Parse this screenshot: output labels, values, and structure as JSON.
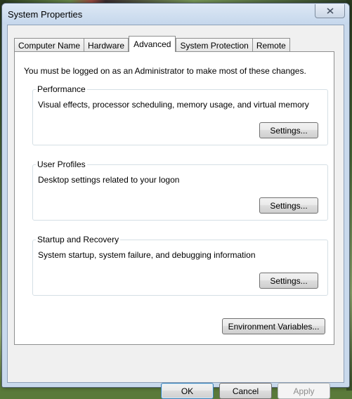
{
  "window": {
    "title": "System Properties",
    "close_icon": "close-icon"
  },
  "tabs": [
    {
      "label": "Computer Name",
      "active": false
    },
    {
      "label": "Hardware",
      "active": false
    },
    {
      "label": "Advanced",
      "active": true
    },
    {
      "label": "System Protection",
      "active": false
    },
    {
      "label": "Remote",
      "active": false
    }
  ],
  "advanced": {
    "admin_note": "You must be logged on as an Administrator to make most of these changes.",
    "performance": {
      "title": "Performance",
      "description": "Visual effects, processor scheduling, memory usage, and virtual memory",
      "button": "Settings..."
    },
    "user_profiles": {
      "title": "User Profiles",
      "description": "Desktop settings related to your logon",
      "button": "Settings..."
    },
    "startup_recovery": {
      "title": "Startup and Recovery",
      "description": "System startup, system failure, and debugging information",
      "button": "Settings..."
    },
    "env_button": "Environment Variables..."
  },
  "footer": {
    "ok": "OK",
    "cancel": "Cancel",
    "apply": "Apply",
    "apply_enabled": false
  },
  "colors": {
    "window_frame": "#c9d9ec",
    "client_bg": "#f0f0f0",
    "panel_bg": "#ffffff",
    "group_border": "#d5dfe5",
    "disabled_text": "#8d8d8d"
  }
}
